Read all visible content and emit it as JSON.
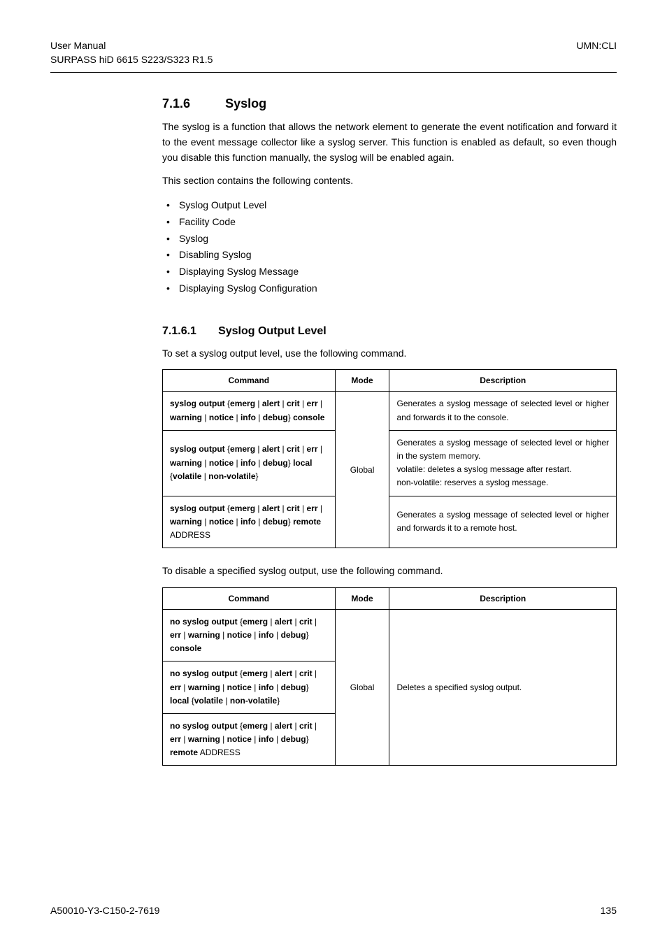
{
  "header": {
    "manual_line1": "User Manual",
    "manual_line2": "SURPASS hiD 6615 S223/S323 R1.5",
    "right": "UMN:CLI"
  },
  "section": {
    "num": "7.1.6",
    "title": "Syslog",
    "para1": "The syslog is a function that allows the network element to generate the event notification and forward it to the event message collector like a syslog server. This function is enabled as default, so even though you disable this function manually, the syslog will be enabled again.",
    "para2": "This section contains the following contents.",
    "bullets": [
      "Syslog Output Level",
      "Facility Code",
      "Syslog",
      "Disabling Syslog",
      "Displaying Syslog Message",
      "Displaying Syslog Configuration"
    ]
  },
  "subsection": {
    "num": "7.1.6.1",
    "title": "Syslog Output Level",
    "intro1": "To set a syslog output level, use the following command.",
    "intro2": "To disable a specified syslog output, use the following command."
  },
  "table_headers": {
    "command": "Command",
    "mode": "Mode",
    "description": "Description"
  },
  "table1": {
    "mode": "Global",
    "rows": [
      {
        "cmd_parts": {
          "p1": "syslog output",
          "p2": " {",
          "p3": "emerg",
          "p4": " | ",
          "p5": "alert",
          "p6": " | ",
          "p7": "crit",
          "p8": " | ",
          "p9": "err",
          "p10": " | ",
          "p11": "warning",
          "p12": " | ",
          "p13": "notice",
          "p14": " | ",
          "p15": "info",
          "p16": " | ",
          "p17": "debug",
          "p18": "} ",
          "p19": "console"
        },
        "desc": "Generates a syslog message of selected level or higher and forwards it to the console."
      },
      {
        "cmd_parts": {
          "p1": "syslog output",
          "p2": " {",
          "p3": "emerg",
          "p4": " | ",
          "p5": "alert",
          "p6": " | ",
          "p7": "crit",
          "p8": " | ",
          "p9": "err",
          "p10": " | ",
          "p11": "warning",
          "p12": " | ",
          "p13": "notice",
          "p14": " | ",
          "p15": "info",
          "p16": " | ",
          "p17": "debug",
          "p18": "} ",
          "p19": "local",
          "p20": " {",
          "p21": "volatile",
          "p22": " | ",
          "p23": "non-volatile",
          "p24": "}"
        },
        "desc_lines": [
          "Generates a syslog message of selected level or higher in the system memory.",
          "volatile: deletes a syslog message after restart.",
          "non-volatile: reserves a syslog message."
        ]
      },
      {
        "cmd_parts": {
          "p1": "syslog output",
          "p2": " {",
          "p3": "emerg",
          "p4": " | ",
          "p5": "alert",
          "p6": " | ",
          "p7": "crit",
          "p8": " | ",
          "p9": "err",
          "p10": " | ",
          "p11": "warning",
          "p12": " | ",
          "p13": "notice",
          "p14": " | ",
          "p15": "info",
          "p16": " | ",
          "p17": "debug",
          "p18": "} ",
          "p19": "remote",
          "p20": " ",
          "p21": "ADDRESS"
        },
        "desc": "Generates a syslog message of selected level or higher and forwards it to a remote host."
      }
    ]
  },
  "table2": {
    "mode": "Global",
    "desc": "Deletes a specified syslog output.",
    "rows": [
      {
        "cmd_parts": {
          "p1": "no syslog output",
          "p2": " {",
          "p3": "emerg",
          "p4": " | ",
          "p5": "alert",
          "p6": " | ",
          "p7": "crit",
          "p8": " | ",
          "p9": "err",
          "p10": " | ",
          "p11": "warning",
          "p12": " | ",
          "p13": "notice",
          "p14": " | ",
          "p15": "info",
          "p16": " | ",
          "p17": "debug",
          "p18": "} ",
          "p19": "console"
        }
      },
      {
        "cmd_parts": {
          "p1": "no syslog output",
          "p2": " {",
          "p3": "emerg",
          "p4": " | ",
          "p5": "alert",
          "p6": " | ",
          "p7": "crit",
          "p8": " | ",
          "p9": "err",
          "p10": " | ",
          "p11": "warning",
          "p12": " | ",
          "p13": "notice",
          "p14": " | ",
          "p15": "info",
          "p16": " | ",
          "p17": "debug",
          "p18": "} ",
          "p19": "local",
          "p20": " {",
          "p21": "volatile",
          "p22": " | ",
          "p23": "non-volatile",
          "p24": "}"
        }
      },
      {
        "cmd_parts": {
          "p1": "no syslog output",
          "p2": " {",
          "p3": "emerg",
          "p4": " | ",
          "p5": "alert",
          "p6": " | ",
          "p7": "crit",
          "p8": " | ",
          "p9": "err",
          "p10": " | ",
          "p11": "warning",
          "p12": " | ",
          "p13": "notice",
          "p14": " | ",
          "p15": "info",
          "p16": " | ",
          "p17": "debug",
          "p18": "} ",
          "p19": "remote",
          "p20": " ",
          "p21": "ADDRESS"
        }
      }
    ]
  },
  "footer": {
    "left": "A50010-Y3-C150-2-7619",
    "right": "135"
  }
}
